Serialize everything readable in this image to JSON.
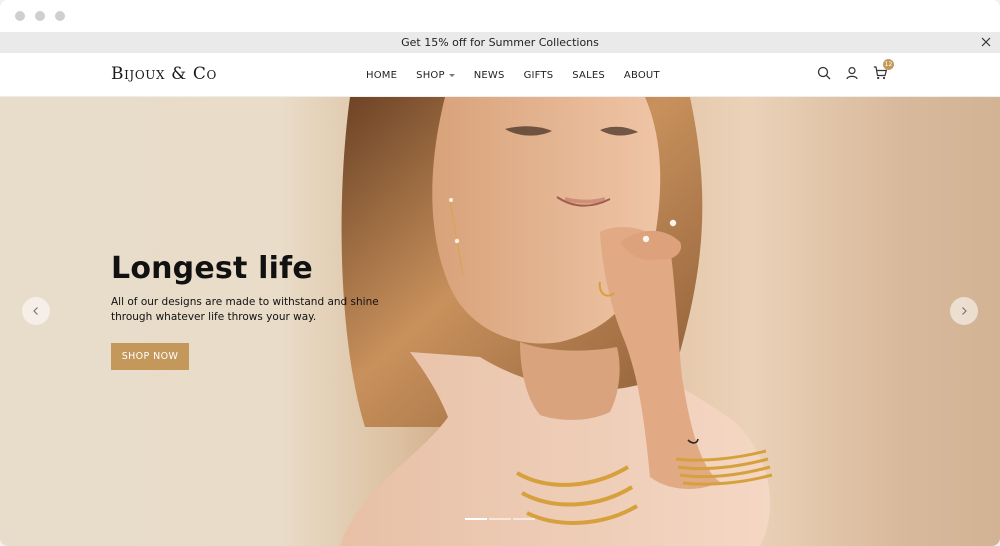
{
  "promo": {
    "text": "Get 15% off for Summer Collections"
  },
  "brand": {
    "logo": "Bijoux & Co"
  },
  "navigation": {
    "items": [
      {
        "label": "HOME"
      },
      {
        "label": "SHOP"
      },
      {
        "label": "NEWS"
      },
      {
        "label": "GIFTS"
      },
      {
        "label": "SALES"
      },
      {
        "label": "ABOUT"
      }
    ]
  },
  "header_actions": {
    "search_icon": "search-icon",
    "account_icon": "user-icon",
    "cart_icon": "cart-icon",
    "cart_count": "12"
  },
  "hero": {
    "title": "Longest life",
    "description": "All of our designs are made to withstand and shine through whatever life throws your way.",
    "button": "SHOP NOW",
    "slide_count": 3,
    "active_slide": 1
  },
  "colors": {
    "accent": "#c4985a",
    "promo_bg": "#eaeaea",
    "text_dark": "#111111"
  }
}
